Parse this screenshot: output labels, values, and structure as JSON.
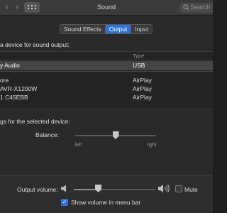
{
  "window": {
    "title": "Sound"
  },
  "toolbar": {
    "back_glyph": "‹",
    "forward_glyph": "›",
    "search_placeholder": "Search"
  },
  "tabs": [
    {
      "label": "Sound Effects",
      "active": false
    },
    {
      "label": "Output",
      "active": true
    },
    {
      "label": "Input",
      "active": false
    }
  ],
  "output": {
    "heading": "a device for sound output:",
    "columns": {
      "name": "",
      "type": "Type"
    },
    "devices": [
      {
        "name": "y Audio",
        "type": "USB",
        "selected": true
      },
      {
        "name": "ore",
        "type": "AirPlay",
        "selected": false
      },
      {
        "name": "AVR-X1200W",
        "type": "AirPlay",
        "selected": false
      },
      {
        "name": "1 C45EBB",
        "type": "AirPlay",
        "selected": false
      }
    ]
  },
  "settings": {
    "heading": "gs for the selected device:",
    "balance_label": "Balance:",
    "balance_left": "left",
    "balance_right": "right",
    "balance_value": 0.5
  },
  "volume": {
    "label": "Output volume:",
    "value": 0.3,
    "mute_label": "Mute",
    "mute_checked": false,
    "show_in_menu_bar_label": "Show volume in menu bar",
    "show_in_menu_bar_checked": true,
    "check_glyph": "✓"
  },
  "colors": {
    "accent": "#2f73d9",
    "selected_row": "#454545",
    "background": "#2a2a2a"
  },
  "icons": [
    "chevron-left-icon",
    "chevron-right-icon",
    "grid-icon",
    "search-icon",
    "speaker-low-icon",
    "speaker-high-icon",
    "checkmark-icon"
  ]
}
